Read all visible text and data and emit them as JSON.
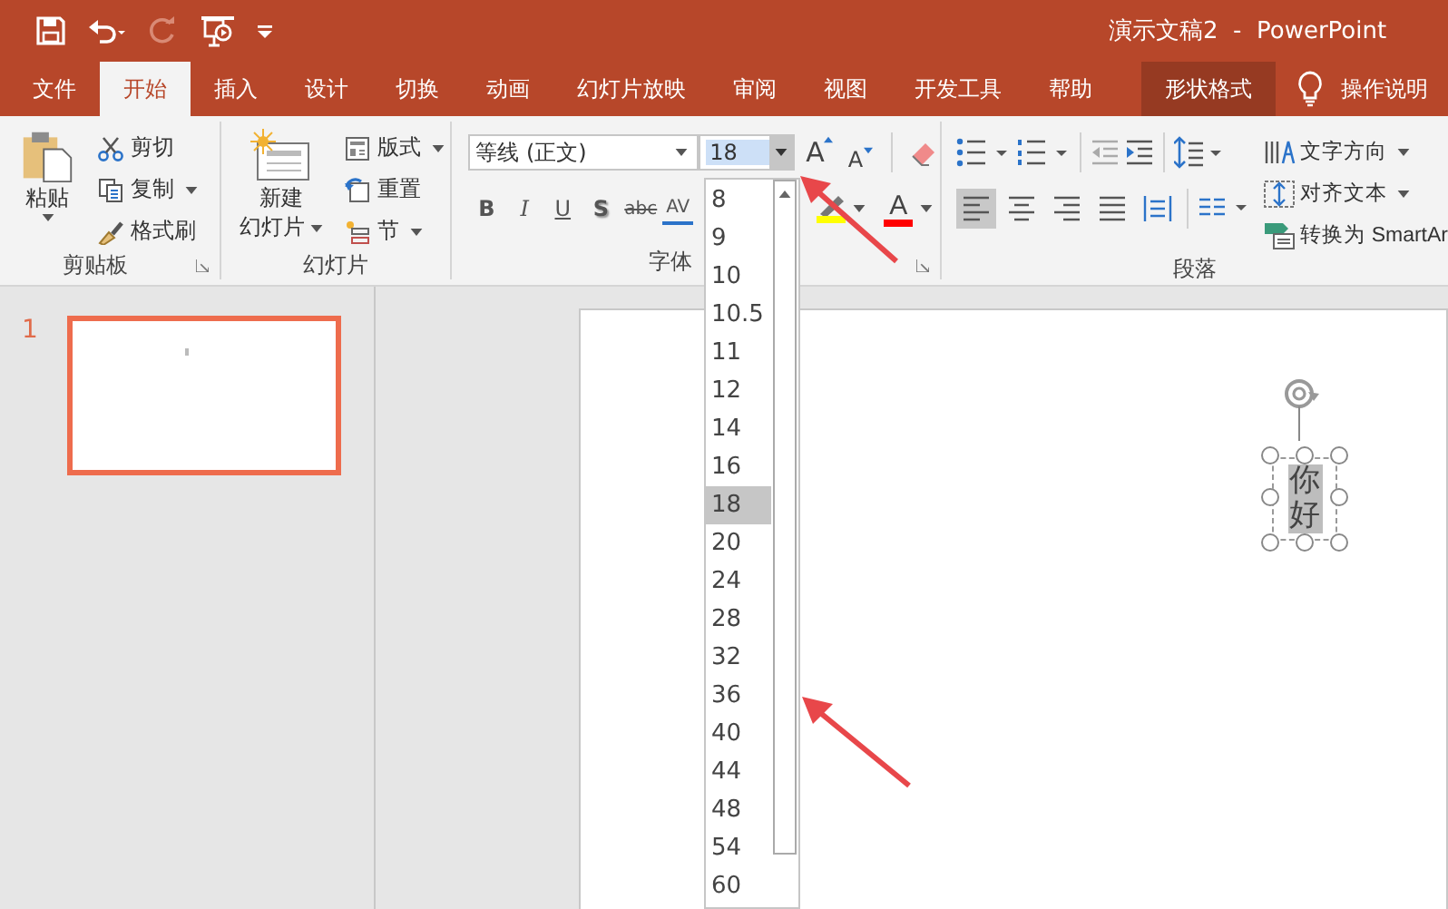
{
  "quick_access": {
    "redo": {
      "disabled": true
    }
  },
  "title_bar": {
    "title": "演示文稿2  -  PowerPoint"
  },
  "tabs": [
    {
      "label": "文件",
      "selected": false,
      "kind": "normal"
    },
    {
      "label": "开始",
      "selected": true,
      "kind": "normal"
    },
    {
      "label": "插入",
      "selected": false,
      "kind": "normal"
    },
    {
      "label": "设计",
      "selected": false,
      "kind": "normal"
    },
    {
      "label": "切换",
      "selected": false,
      "kind": "normal"
    },
    {
      "label": "动画",
      "selected": false,
      "kind": "normal"
    },
    {
      "label": "幻灯片放映",
      "selected": false,
      "kind": "normal"
    },
    {
      "label": "审阅",
      "selected": false,
      "kind": "normal"
    },
    {
      "label": "视图",
      "selected": false,
      "kind": "normal"
    },
    {
      "label": "开发工具",
      "selected": false,
      "kind": "normal"
    },
    {
      "label": "帮助",
      "selected": false,
      "kind": "normal"
    },
    {
      "label": "形状格式",
      "selected": false,
      "kind": "contextual"
    }
  ],
  "tell_me": "操作说明",
  "clipboard": {
    "label": "剪贴板",
    "paste": "粘贴",
    "small_buttons": [
      {
        "kind": "cut",
        "label": "剪切"
      },
      {
        "kind": "copy",
        "label": "复制"
      },
      {
        "kind": "painter",
        "label": "格式刷"
      }
    ]
  },
  "slides": {
    "label": "幻灯片",
    "new_slide": [
      "新建",
      "幻灯片"
    ],
    "small_buttons": [
      {
        "kind": "layout",
        "label": "版式"
      },
      {
        "kind": "reset",
        "label": "重置"
      },
      {
        "kind": "section",
        "label": "节"
      }
    ]
  },
  "font": {
    "label": "字体",
    "font_name": "等线 (正文)",
    "font_size": "18",
    "size_buttons": [
      {
        "kind": "grow",
        "label": "A"
      },
      {
        "kind": "shrink",
        "label": "A"
      }
    ],
    "format_buttons": [
      {
        "kind": "bold",
        "label": "B"
      },
      {
        "kind": "italic",
        "label": "I"
      },
      {
        "kind": "underline",
        "label": "U"
      },
      {
        "kind": "shadow",
        "label": "S"
      },
      {
        "kind": "strike",
        "label": "abc"
      },
      {
        "kind": "spacing",
        "label": "AV"
      }
    ],
    "color_buttons": [
      {
        "kind": "highlight",
        "color": "#ffff00"
      },
      {
        "kind": "font_color",
        "label": "A",
        "color": "#ff0000"
      }
    ]
  },
  "paragraph": {
    "label": "段落",
    "align_buttons": [
      {
        "kind": "left",
        "selected": true
      },
      {
        "kind": "center",
        "selected": false
      },
      {
        "kind": "right",
        "selected": false
      },
      {
        "kind": "justify",
        "selected": false
      },
      {
        "kind": "distributed",
        "selected": false
      }
    ],
    "text_buttons": [
      {
        "kind": "direction",
        "label": "文字方向",
        "caret": true
      },
      {
        "kind": "align",
        "label": "对齐文本",
        "caret": true
      },
      {
        "kind": "smartart",
        "label": "转换为 SmartAr",
        "caret": false
      }
    ]
  },
  "slide_panel": {
    "slides": [
      {
        "number": "1",
        "selected": true
      }
    ]
  },
  "size_dropdown": {
    "items": [
      {
        "label": "8",
        "selected": false
      },
      {
        "label": "9",
        "selected": false
      },
      {
        "label": "10",
        "selected": false
      },
      {
        "label": "10.5",
        "selected": false
      },
      {
        "label": "11",
        "selected": false
      },
      {
        "label": "12",
        "selected": false
      },
      {
        "label": "14",
        "selected": false
      },
      {
        "label": "16",
        "selected": false
      },
      {
        "label": "18",
        "selected": true
      },
      {
        "label": "20",
        "selected": false
      },
      {
        "label": "24",
        "selected": false
      },
      {
        "label": "28",
        "selected": false
      },
      {
        "label": "32",
        "selected": false
      },
      {
        "label": "36",
        "selected": false
      },
      {
        "label": "40",
        "selected": false
      },
      {
        "label": "44",
        "selected": false
      },
      {
        "label": "48",
        "selected": false
      },
      {
        "label": "54",
        "selected": false
      },
      {
        "label": "60",
        "selected": false
      }
    ]
  },
  "text_box": {
    "text": "你好",
    "selected": true
  }
}
